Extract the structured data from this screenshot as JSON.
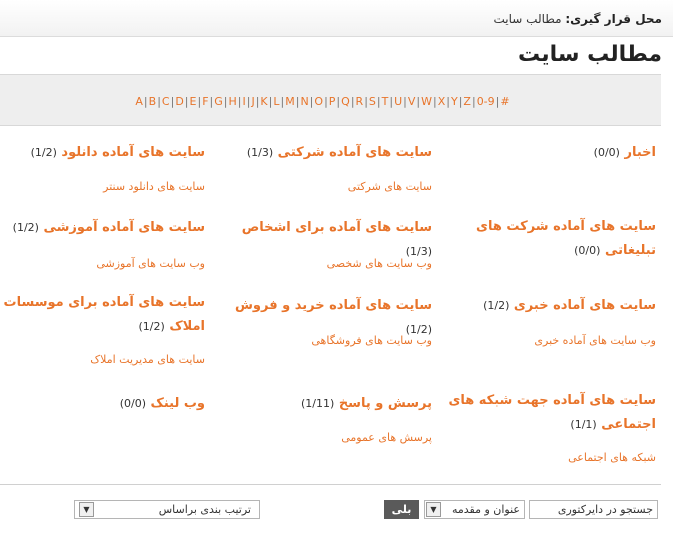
{
  "breadcrumb": {
    "label": "محل قرار گیری:",
    "current": "مطالب سایت"
  },
  "page_title": "مطالب سایت",
  "alphabet": [
    "A",
    "B",
    "C",
    "D",
    "E",
    "F",
    "G",
    "H",
    "I",
    "J",
    "K",
    "L",
    "M",
    "N",
    "O",
    "P",
    "Q",
    "R",
    "S",
    "T",
    "U",
    "V",
    "W",
    "X",
    "Y",
    "Z",
    "0-9",
    "#"
  ],
  "categories": [
    {
      "title": "اخبار",
      "count": "(0/0)",
      "subs": []
    },
    {
      "title": "سایت های آماده شرکتی",
      "count": "(1/3)",
      "subs": [
        "سایت های شرکتی"
      ]
    },
    {
      "title": "سایت های آماده دانلود",
      "count": "(1/2)",
      "subs": [
        "سایت های دانلود سنتر"
      ]
    },
    {
      "title": "سایت های آماده شرکت های تبلیغاتی",
      "count": "(0/0)",
      "subs": []
    },
    {
      "title": "سایت های آماده برای اشخاص",
      "count": "(1/3)",
      "subs": [
        "وب سایت های شخصی"
      ]
    },
    {
      "title": "سایت های آماده آموزشی",
      "count": "(1/2)",
      "subs": [
        "وب سایت های آموزشی"
      ]
    },
    {
      "title": "سایت های آماده خبری",
      "count": "(1/2)",
      "subs": [
        "وب سایت های آماده خبری"
      ]
    },
    {
      "title": "سایت های آماده خرید و فروش",
      "count": "(1/2)",
      "subs": [
        "وب سایت های فروشگاهی"
      ]
    },
    {
      "title": "سایت های آماده برای موسسات املاک",
      "count": "(1/2)",
      "subs": [
        "سایت های مدیریت املاک"
      ]
    },
    {
      "title": "سایت های آماده جهت شبکه های اجتماعی",
      "count": "(1/1)",
      "subs": [
        "شبکه های اجتماعی"
      ]
    },
    {
      "title": "پرسش و پاسخ",
      "count": "(1/11)",
      "subs": [
        "پرسش های عمومی"
      ]
    },
    {
      "title": "وب لینک",
      "count": "(0/0)",
      "subs": []
    }
  ],
  "search": {
    "field_label": "جستجو در دایرکتوری",
    "scope_value": "عنوان و مقدمه",
    "button_label": "بلی",
    "sort_value": "ترتیب بندی براساس"
  },
  "colors": {
    "accent": "#e8742a",
    "button": "#5a5a5a",
    "band": "#eeeeee"
  }
}
